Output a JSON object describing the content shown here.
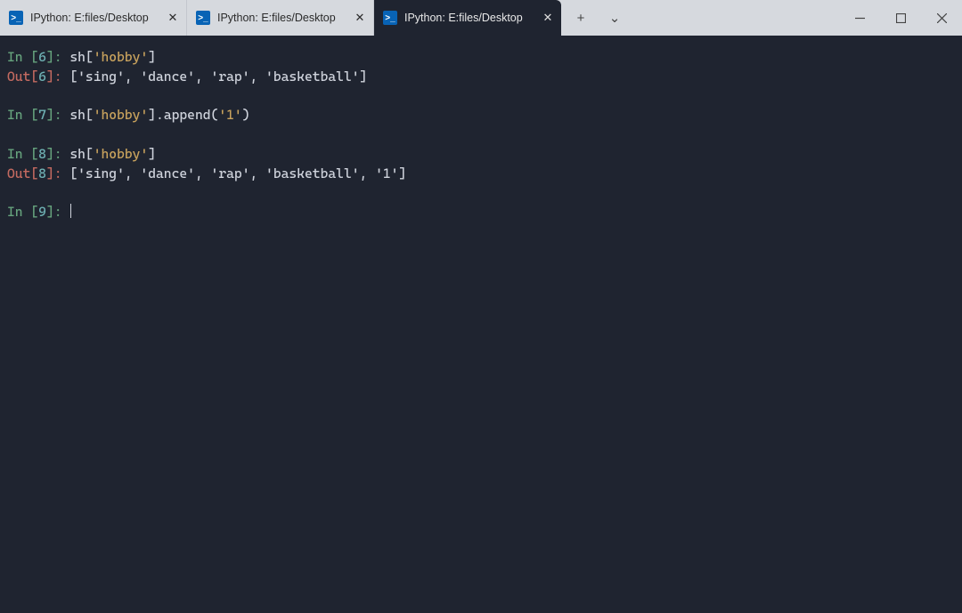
{
  "window": {
    "tabs": [
      {
        "label": "IPython: E:files/Desktop",
        "active": false
      },
      {
        "label": "IPython: E:files/Desktop",
        "active": false
      },
      {
        "label": "IPython: E:files/Desktop",
        "active": true
      }
    ],
    "glyphs": {
      "ps": ">_",
      "close": "✕",
      "new_tab": "+",
      "dropdown": "⌄"
    }
  },
  "syntax": {
    "in_prefix": "In [",
    "out_prefix": "Out[",
    "suffix": "]: "
  },
  "terminal": {
    "lines": [
      {
        "kind": "in",
        "n": "6",
        "tokens": [
          {
            "t": "sh[",
            "c": "white"
          },
          {
            "t": "'hobby'",
            "c": "yellow"
          },
          {
            "t": "]",
            "c": "white"
          }
        ]
      },
      {
        "kind": "out",
        "n": "6",
        "tokens": [
          {
            "t": "['sing', 'dance', 'rap', 'basketball']",
            "c": "white"
          }
        ]
      },
      {
        "kind": "blank"
      },
      {
        "kind": "in",
        "n": "7",
        "tokens": [
          {
            "t": "sh[",
            "c": "white"
          },
          {
            "t": "'hobby'",
            "c": "yellow"
          },
          {
            "t": "].append(",
            "c": "white"
          },
          {
            "t": "'1'",
            "c": "yellow"
          },
          {
            "t": ")",
            "c": "white"
          }
        ]
      },
      {
        "kind": "blank"
      },
      {
        "kind": "in",
        "n": "8",
        "tokens": [
          {
            "t": "sh[",
            "c": "white"
          },
          {
            "t": "'hobby'",
            "c": "yellow"
          },
          {
            "t": "]",
            "c": "white"
          }
        ]
      },
      {
        "kind": "out",
        "n": "8",
        "tokens": [
          {
            "t": "['sing', 'dance', 'rap', 'basketball', '1']",
            "c": "white"
          }
        ]
      },
      {
        "kind": "blank"
      },
      {
        "kind": "in",
        "n": "9",
        "tokens": [],
        "cursor": true
      }
    ]
  }
}
